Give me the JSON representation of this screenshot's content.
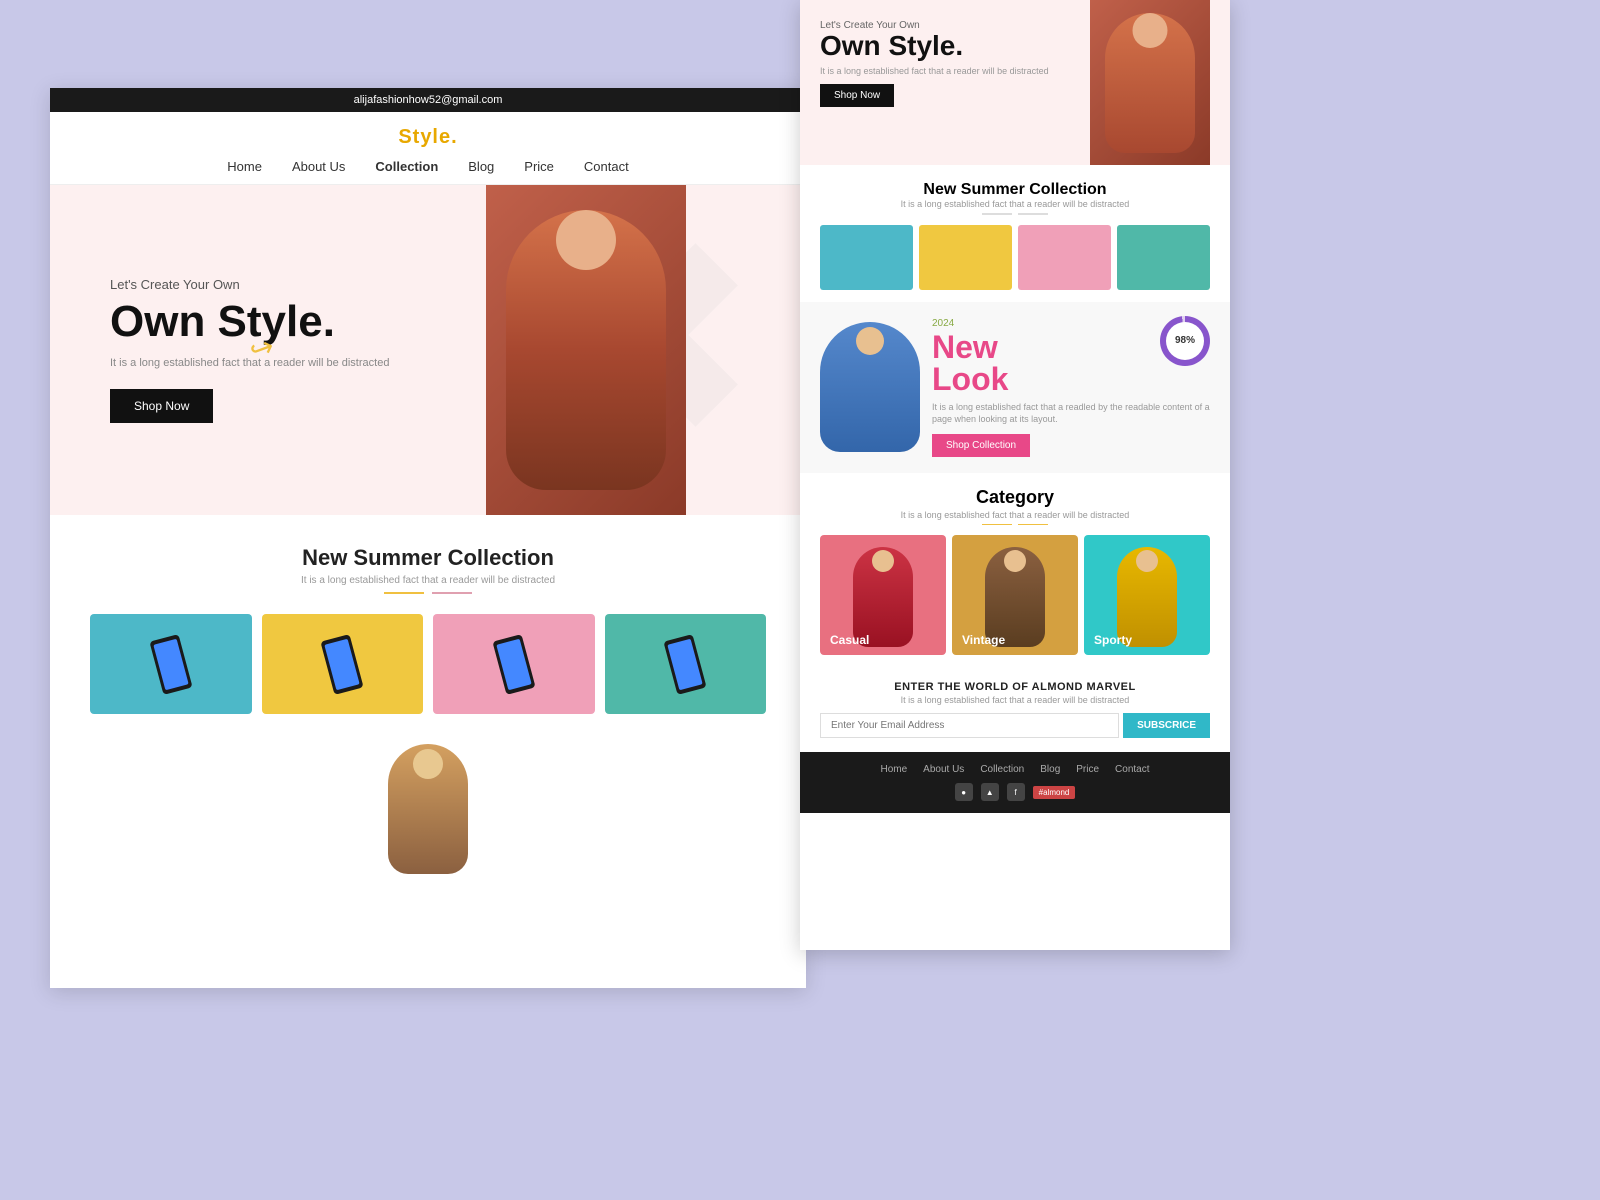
{
  "page": {
    "background_color": "#c8c8e8"
  },
  "main_window": {
    "top_bar": {
      "email": "alijafashionhow52@gmail.com"
    },
    "header": {
      "logo": "Style.",
      "logo_dot_color": "#e8a800",
      "nav": [
        {
          "label": "Home",
          "active": false
        },
        {
          "label": "About Us",
          "active": false
        },
        {
          "label": "Collection",
          "active": true
        },
        {
          "label": "Blog",
          "active": false
        },
        {
          "label": "Price",
          "active": false
        },
        {
          "label": "Contact",
          "active": false
        }
      ]
    },
    "hero": {
      "tagline": "Let's Create Your Own",
      "title": "Own Style.",
      "subtitle": "It is a long established fact that a reader will be distracted",
      "cta": "Shop Now"
    },
    "collection": {
      "title": "New Summer Collection",
      "subtitle": "It is a long established fact that a reader will be distracted",
      "cards": [
        {
          "color": "teal"
        },
        {
          "color": "yellow"
        },
        {
          "color": "pink"
        },
        {
          "color": "teal2"
        }
      ]
    }
  },
  "secondary_window": {
    "hero": {
      "tagline": "Let's Create Your Own",
      "title": "Own Style.",
      "subtitle": "It is a long established fact that a reader will be distracted",
      "cta": "Shop Now"
    },
    "collection": {
      "title": "New Summer Collection",
      "subtitle": "It is a long established fact that a reader will be distracted"
    },
    "new_look": {
      "year": "2024",
      "title_black": "New",
      "title_pink": "Look",
      "description": "It is a long established fact that a readled by the readable content of a page when looking at its layout.",
      "cta": "Shop Collection",
      "progress_value": "98%"
    },
    "category": {
      "title": "Category",
      "subtitle": "It is a long established fact that a reader will be distracted",
      "items": [
        {
          "label": "Casual",
          "color": "casual"
        },
        {
          "label": "Vintage",
          "color": "vintage"
        },
        {
          "label": "Sporty",
          "color": "sporty"
        }
      ]
    },
    "subscribe": {
      "title": "ENTER THE WORLD OF ALMOND MARVEL",
      "subtitle": "It is a long established fact that a reader will be distracted",
      "placeholder": "Enter Your Email Address",
      "button": "SUBSCRICE"
    },
    "footer": {
      "nav": [
        {
          "label": "Home"
        },
        {
          "label": "About Us"
        },
        {
          "label": "Collection"
        },
        {
          "label": "Blog"
        },
        {
          "label": "Price"
        },
        {
          "label": "Contact"
        }
      ],
      "social_tag": "#almond"
    }
  }
}
